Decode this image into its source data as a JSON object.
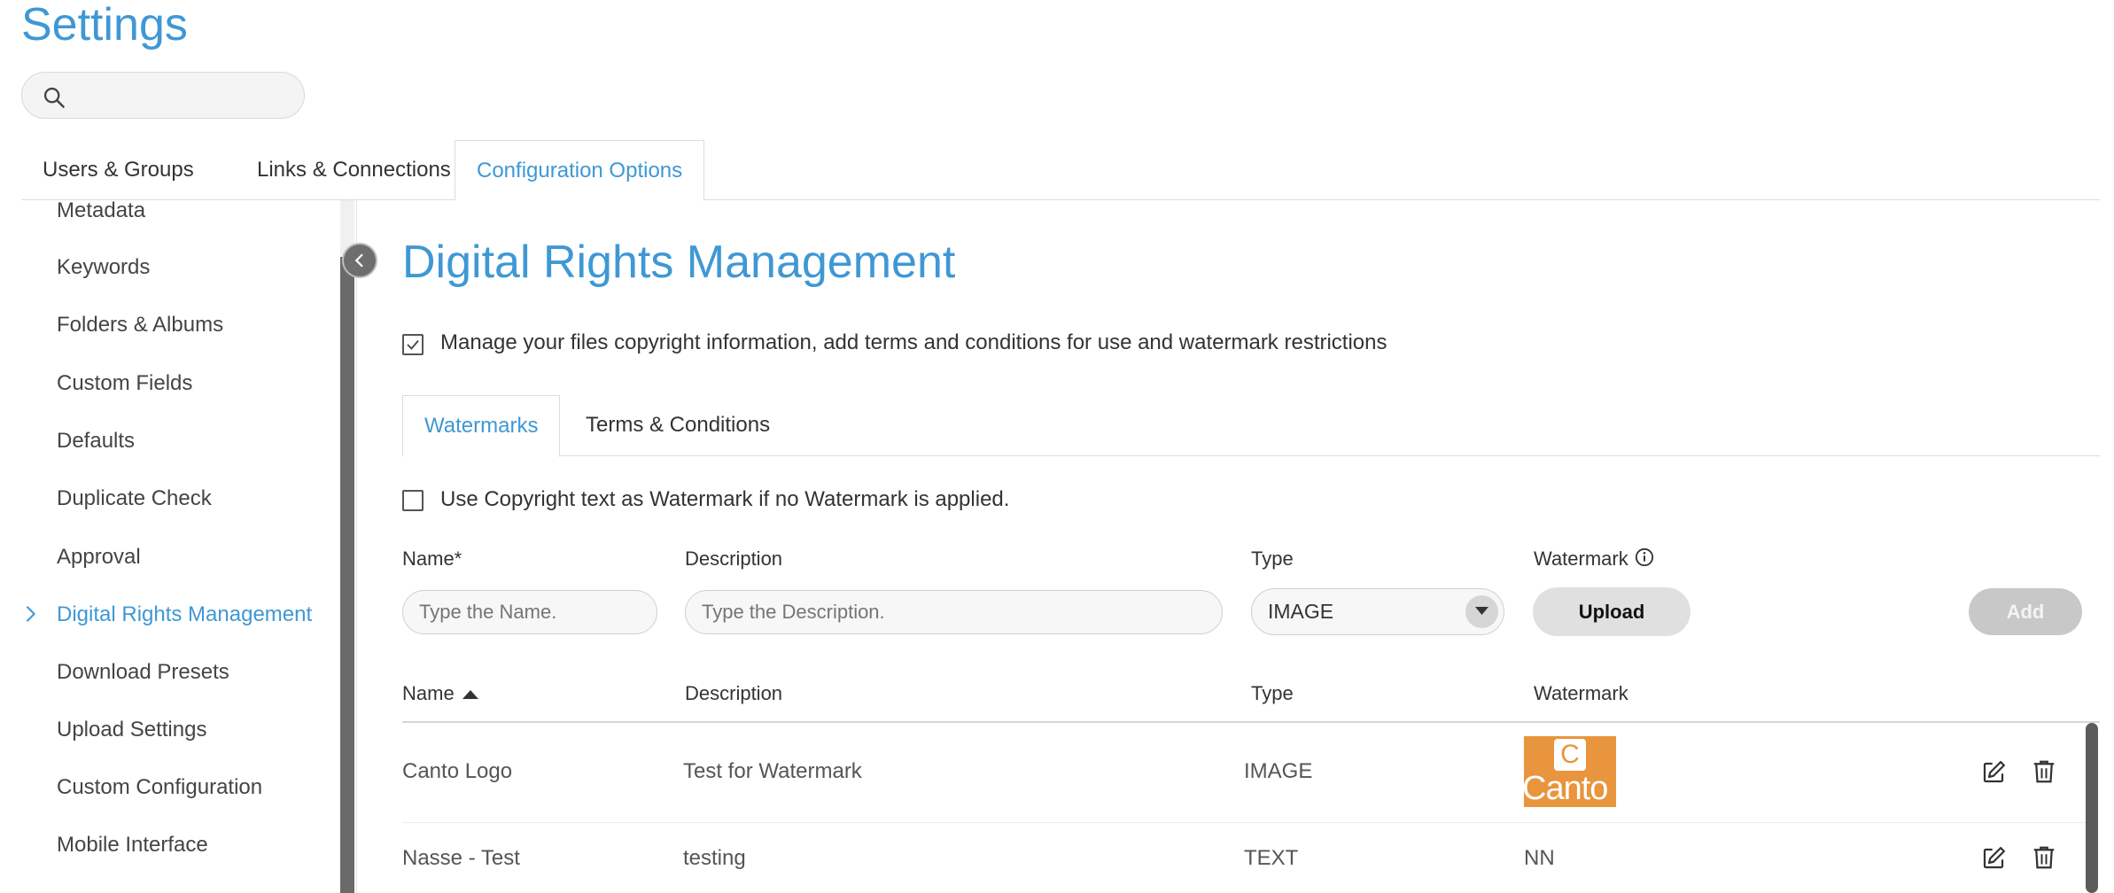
{
  "page": {
    "title": "Settings"
  },
  "search": {
    "placeholder": ""
  },
  "top_tabs": [
    {
      "label": "Users & Groups"
    },
    {
      "label": "Links & Connections"
    },
    {
      "label": "Configuration Options"
    }
  ],
  "sidebar": {
    "items": [
      {
        "label": "Metadata"
      },
      {
        "label": "Keywords"
      },
      {
        "label": "Folders & Albums"
      },
      {
        "label": "Custom Fields"
      },
      {
        "label": "Defaults"
      },
      {
        "label": "Duplicate Check"
      },
      {
        "label": "Approval"
      },
      {
        "label": "Digital Rights Management"
      },
      {
        "label": "Download Presets"
      },
      {
        "label": "Upload Settings"
      },
      {
        "label": "Custom Configuration"
      },
      {
        "label": "Mobile Interface"
      }
    ],
    "active_index": 7
  },
  "main": {
    "title": "Digital Rights Management",
    "manage_checkbox": {
      "label": "Manage your files copyright information, add terms and conditions for use and watermark restrictions",
      "checked": true
    },
    "sub_tabs": [
      {
        "label": "Watermarks"
      },
      {
        "label": "Terms & Conditions"
      }
    ],
    "copyright_checkbox": {
      "label": "Use Copyright text as Watermark if no Watermark is applied.",
      "checked": false
    },
    "form": {
      "name_label": "Name*",
      "name_placeholder": "Type the Name.",
      "description_label": "Description",
      "description_placeholder": "Type the Description.",
      "type_label": "Type",
      "type_value": "IMAGE",
      "watermark_label": "Watermark",
      "upload_label": "Upload",
      "add_label": "Add"
    },
    "table": {
      "headers": {
        "name": "Name",
        "description": "Description",
        "type": "Type",
        "watermark": "Watermark"
      },
      "rows": [
        {
          "name": "Canto Logo",
          "description": "Test for Watermark",
          "type": "IMAGE",
          "watermark_logo": {
            "letter": "C",
            "word": "Canto"
          }
        },
        {
          "name": "Nasse - Test",
          "description": "testing",
          "type": "TEXT",
          "watermark": "NN"
        }
      ]
    }
  },
  "colors": {
    "accent": "#3f98d4",
    "logo_orange": "#e8953e"
  }
}
